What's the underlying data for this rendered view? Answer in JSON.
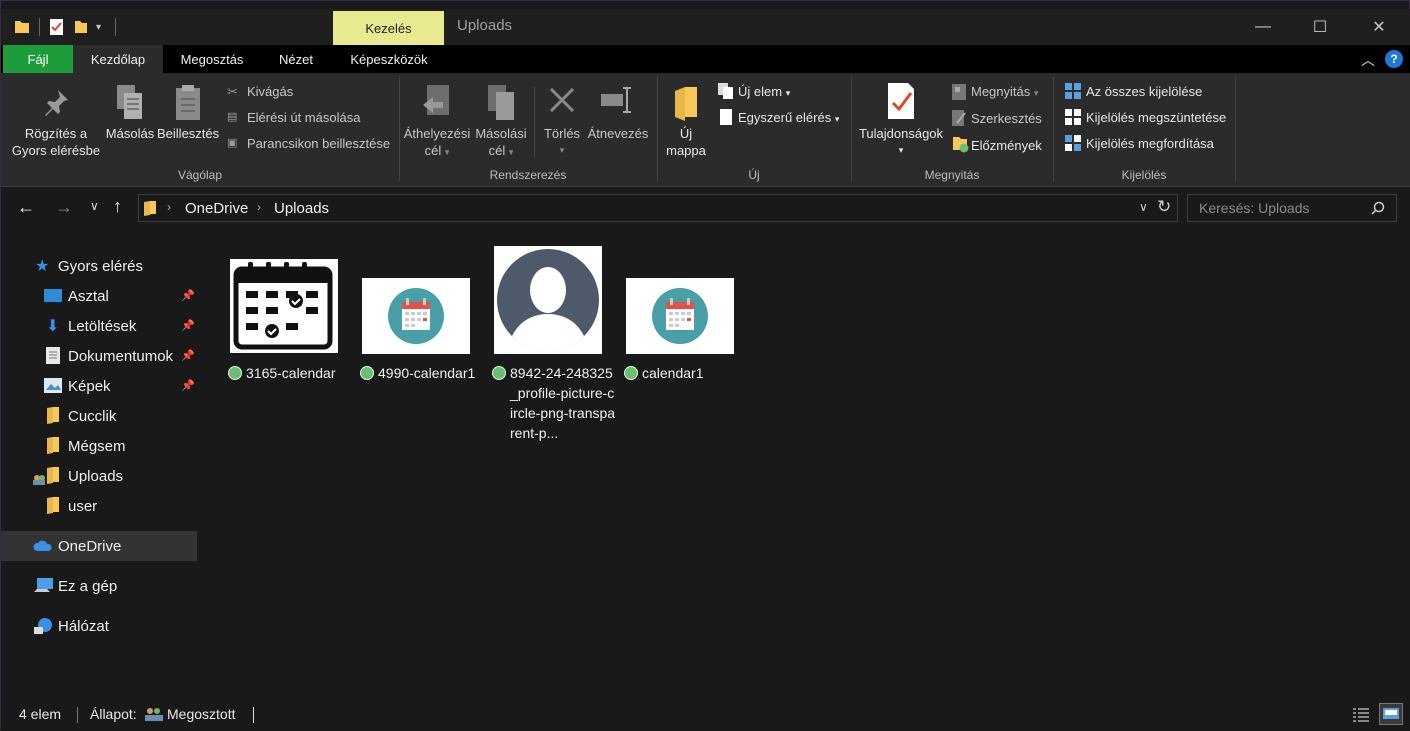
{
  "window": {
    "title": "Uploads",
    "context_tab": "Kezelés",
    "controls": {
      "minimize": "—",
      "maximize": "☐",
      "close": "✕"
    }
  },
  "tabs": [
    "Fájl",
    "Kezdőlap",
    "Megosztás",
    "Nézet",
    "Képeszközök"
  ],
  "ribbon": {
    "clipboard": {
      "pin_line1": "Rögzítés a",
      "pin_line2": "Gyors elérésbe",
      "copy": "Másolás",
      "paste": "Beillesztés",
      "cut": "Kivágás",
      "copy_path": "Elérési út másolása",
      "paste_shortcut": "Parancsikon beillesztése",
      "group": "Vágólap"
    },
    "organize": {
      "move_line1": "Áthelyezési",
      "move_line2": "cél",
      "copyto_line1": "Másolási",
      "copyto_line2": "cél",
      "delete": "Törlés",
      "rename": "Átnevezés",
      "group": "Rendszerezés"
    },
    "new": {
      "folder_line1": "Új",
      "folder_line2": "mappa",
      "new_item": "Új elem",
      "easy_access": "Egyszerű elérés",
      "group": "Új"
    },
    "open": {
      "properties": "Tulajdonságok",
      "open": "Megnyitás",
      "edit": "Szerkesztés",
      "history": "Előzmények",
      "group": "Megnyitás"
    },
    "select": {
      "select_all": "Az összes kijelölése",
      "select_none": "Kijelölés megszüntetése",
      "invert": "Kijelölés megfordítása",
      "group": "Kijelölés"
    }
  },
  "address": {
    "crumbs": [
      "OneDrive",
      "Uploads"
    ],
    "search_placeholder": "Keresés: Uploads"
  },
  "nav": {
    "quick_access": "Gyors elérés",
    "items": [
      "Asztal",
      "Letöltések",
      "Dokumentumok",
      "Képek",
      "Cucclik",
      "Mégsem",
      "Uploads",
      "user"
    ],
    "onedrive": "OneDrive",
    "this_pc": "Ez a gép",
    "network": "Hálózat"
  },
  "files": [
    {
      "name": "3165-calendar"
    },
    {
      "name": "4990-calendar1"
    },
    {
      "name": "8942-24-248325_profile-picture-circle-png-transparent-p..."
    },
    {
      "name": "calendar1"
    }
  ],
  "status": {
    "count": "4 elem",
    "state_label": "Állapot:",
    "state_value": "Megosztott"
  },
  "colors": {
    "file_tab": "#1d9c3c",
    "context_tab": "#e8ea8f",
    "sync_ok": "#6bbf73",
    "calendar_teal": "#4a9ea6"
  }
}
